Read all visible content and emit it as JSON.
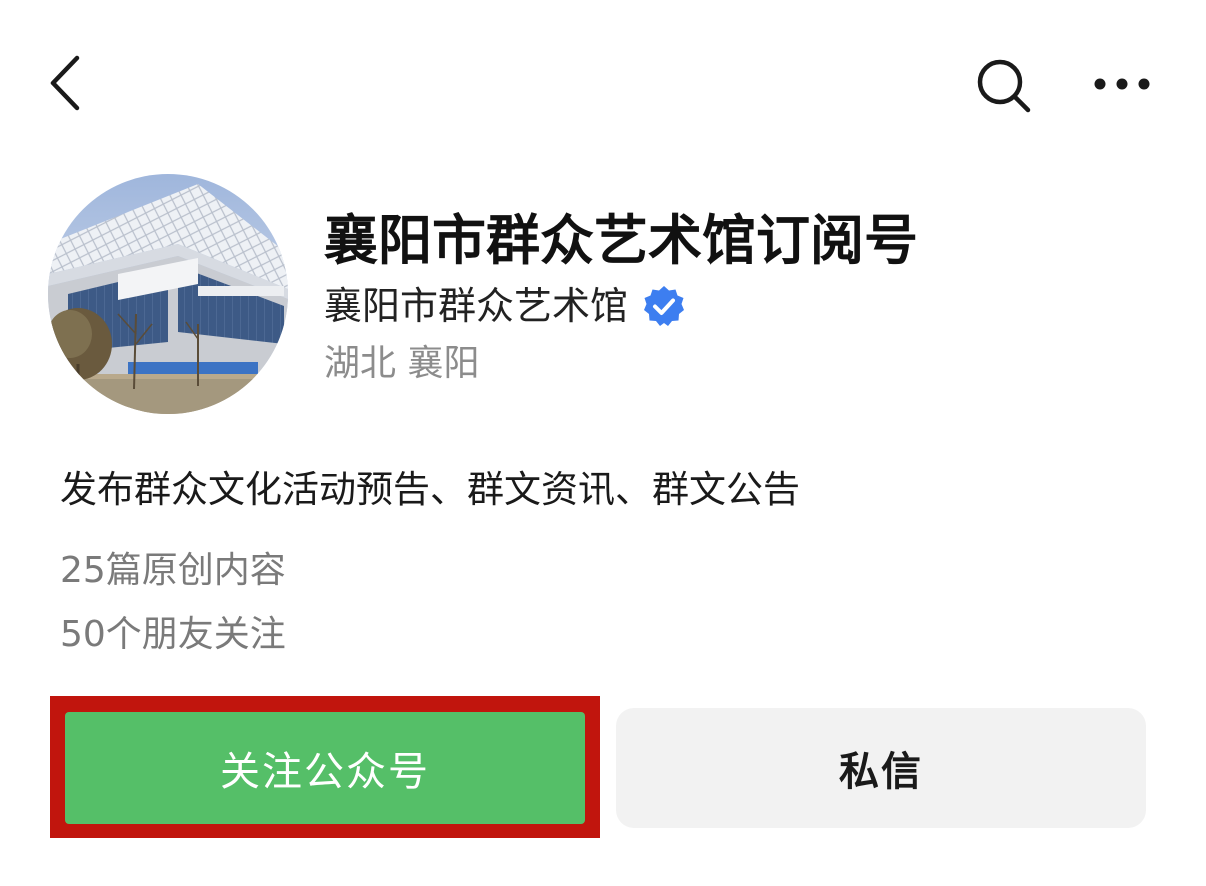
{
  "nav": {
    "back_icon": "chevron-left-icon",
    "search_icon": "search-icon",
    "more_icon": "more-horizontal-icon"
  },
  "account": {
    "title": "襄阳市群众艺术馆订阅号",
    "org_name": "襄阳市群众艺术馆",
    "verified_icon": "verified-badge-icon",
    "verified_color": "#3d7ef0",
    "location": "湖北 襄阳",
    "description": "发布群众文化活动预告、群文资讯、群文公告",
    "original_count": "25篇原创内容",
    "friends_following": "50个朋友关注"
  },
  "actions": {
    "follow_label": "关注公众号",
    "message_label": "私信",
    "follow_color": "#55bf68",
    "highlight_color": "#c1150d"
  }
}
